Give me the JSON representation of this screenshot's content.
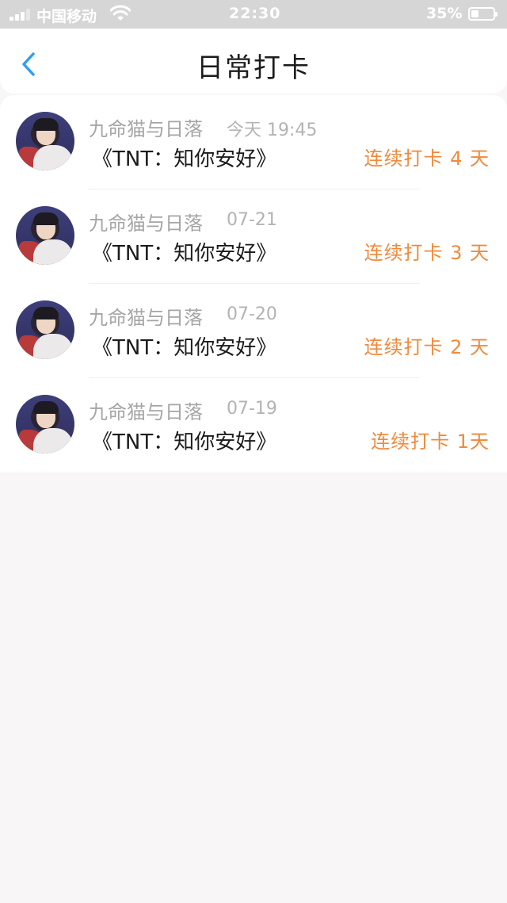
{
  "status_bar": {
    "carrier": "中国移动",
    "time": "22:30",
    "battery": "35%",
    "battery_level": 0.35
  },
  "header": {
    "title": "日常打卡"
  },
  "checkins": [
    {
      "user": "九命猫与日落",
      "time": "今天 19:45",
      "book": "《TNT：知你安好》",
      "streak": "连续打卡 4 天"
    },
    {
      "user": "九命猫与日落",
      "time": "07-21",
      "book": "《TNT：知你安好》",
      "streak": "连续打卡 3 天"
    },
    {
      "user": "九命猫与日落",
      "time": "07-20",
      "book": "《TNT：知你安好》",
      "streak": "连续打卡 2 天"
    },
    {
      "user": "九命猫与日落",
      "time": "07-19",
      "book": "《TNT：知你安好》",
      "streak": "连续打卡 1天"
    }
  ],
  "colors": {
    "accent": "#2f9ff0",
    "streak": "#f08a3c"
  }
}
